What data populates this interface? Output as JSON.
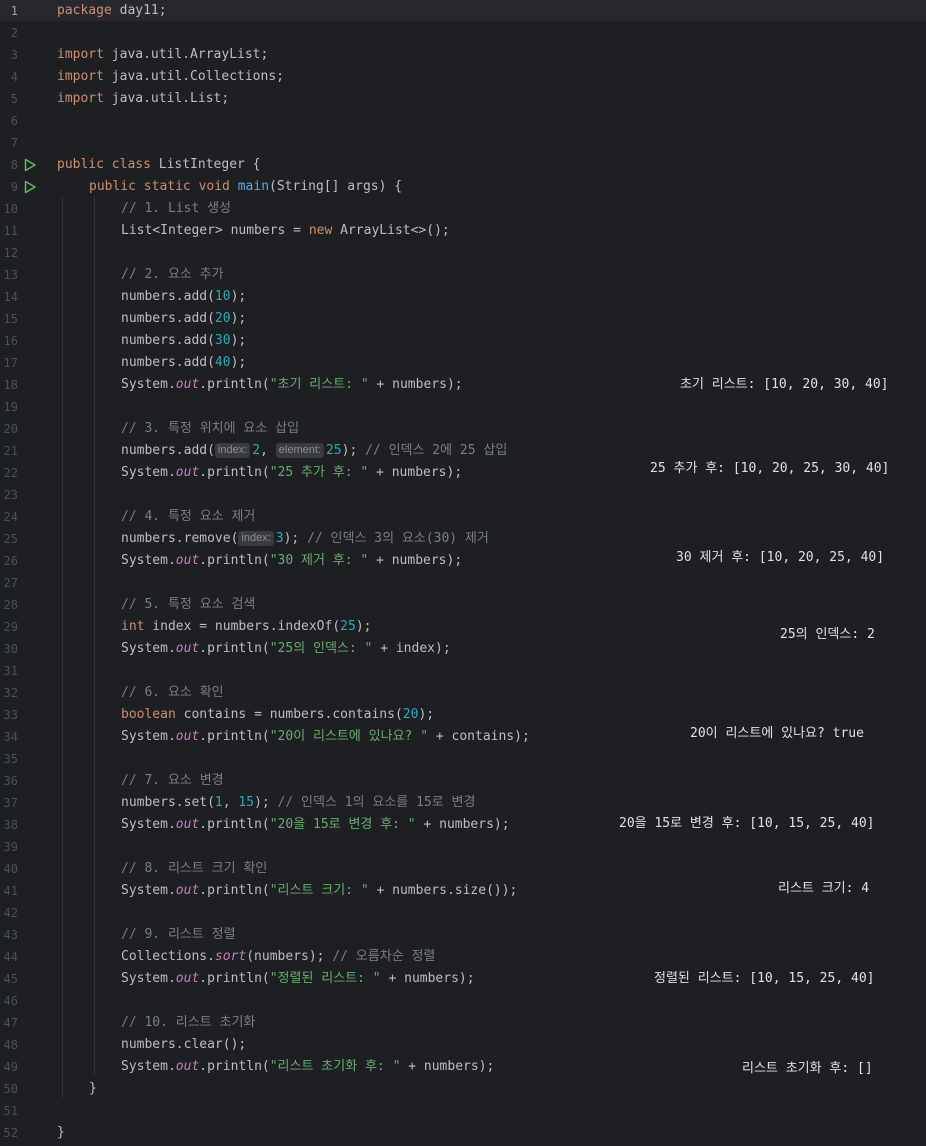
{
  "editor": {
    "line_numbers": [
      "1",
      "2",
      "3",
      "4",
      "5",
      "6",
      "7",
      "8",
      "9",
      "10",
      "11",
      "12",
      "13",
      "14",
      "15",
      "16",
      "17",
      "18",
      "19",
      "20",
      "21",
      "22",
      "23",
      "24",
      "25",
      "26",
      "27",
      "28",
      "29",
      "30",
      "31",
      "32",
      "33",
      "34",
      "35",
      "36",
      "37",
      "38",
      "39",
      "40",
      "41",
      "42",
      "43",
      "44",
      "45",
      "46",
      "47",
      "48",
      "49",
      "50",
      "51",
      "52"
    ],
    "code": {
      "l1": {
        "kw": "package",
        "rest": " day11;"
      },
      "l3": {
        "kw": "import",
        "rest": " java.util.ArrayList;"
      },
      "l4": {
        "kw": "import",
        "rest": " java.util.Collections;"
      },
      "l5": {
        "kw": "import",
        "rest": " java.util.List;"
      },
      "l8": {
        "kw": "public class",
        "rest": " ListInteger {"
      },
      "l9": {
        "kw": "public static void",
        "fn": "main",
        "rest": "(String[] args) {"
      },
      "l10": "// 1. List 생성",
      "l11": {
        "a": "List<Integer> numbers = ",
        "kw": "new",
        "b": " ArrayList<>();"
      },
      "l13": "// 2. 요소 추가",
      "l14": {
        "a": "numbers.add(",
        "n": "10",
        "b": ");"
      },
      "l15": {
        "a": "numbers.add(",
        "n": "20",
        "b": ");"
      },
      "l16": {
        "a": "numbers.add(",
        "n": "30",
        "b": ");"
      },
      "l17": {
        "a": "numbers.add(",
        "n": "40",
        "b": ");"
      },
      "l18": {
        "a": "System.",
        "f": "out",
        "b": ".println(",
        "s": "\"초기 리스트: \"",
        "c": " + numbers);"
      },
      "l20": "// 3. 특정 위치에 요소 삽입",
      "l21": {
        "a": "numbers.add(",
        "h1": "index:",
        "n1": "2",
        ",": ", ",
        "h2": "element:",
        "n2": "25",
        "b": "); ",
        "cm": "// 인덱스 2에 25 삽입"
      },
      "l22": {
        "a": "System.",
        "f": "out",
        "b": ".println(",
        "s": "\"25 추가 후: \"",
        "c": " + numbers);"
      },
      "l24": "// 4. 특정 요소 제거",
      "l25": {
        "a": "numbers.remove(",
        "h": "index:",
        "n": "3",
        "b": "); ",
        "cm": "// 인덱스 3의 요소(30) 제거"
      },
      "l26": {
        "a": "System.",
        "f": "out",
        "b": ".println(",
        "s": "\"30 제거 후: \"",
        "c": " + numbers);"
      },
      "l28": "// 5. 특정 요소 검색",
      "l29": {
        "kw": "int",
        "a": " index = numbers.indexOf(",
        "n": "25",
        "b": ");"
      },
      "l30": {
        "a": "System.",
        "f": "out",
        "b": ".println(",
        "s": "\"25의 인덱스: \"",
        "c": " + index);"
      },
      "l32": "// 6. 요소 확인",
      "l33": {
        "kw": "boolean",
        "a": " contains = numbers.contains(",
        "n": "20",
        "b": ");"
      },
      "l34": {
        "a": "System.",
        "f": "out",
        "b": ".println(",
        "s": "\"20이 리스트에 있나요? \"",
        "c": " + contains);"
      },
      "l36": "// 7. 요소 변경",
      "l37": {
        "a": "numbers.set(",
        "n1": "1",
        ",": ", ",
        "n2": "15",
        "b": "); ",
        "cm": "// 인덱스 1의 요소를 15로 변경"
      },
      "l38": {
        "a": "System.",
        "f": "out",
        "b": ".println(",
        "s": "\"20을 15로 변경 후: \"",
        "c": " + numbers);"
      },
      "l40": "// 8. 리스트 크기 확인",
      "l41": {
        "a": "System.",
        "f": "out",
        "b": ".println(",
        "s": "\"리스트 크기: \"",
        "c": " + numbers.size());"
      },
      "l43": "// 9. 리스트 정렬",
      "l44": {
        "a": "Collections.",
        "f": "sort",
        "b": "(numbers); ",
        "cm": "// 오름차순 정렬"
      },
      "l45": {
        "a": "System.",
        "f": "out",
        "b": ".println(",
        "s": "\"정렬된 리스트: \"",
        "c": " + numbers);"
      },
      "l47": "// 10. 리스트 초기화",
      "l48": "numbers.clear();",
      "l49": {
        "a": "System.",
        "f": "out",
        "b": ".println(",
        "s": "\"리스트 초기화 후: \"",
        "c": " + numbers);"
      },
      "l50": "}",
      "l52": "}"
    },
    "outputs": {
      "o18": "초기 리스트: [10, 20, 30, 40]",
      "o22": "25 추가 후: [10, 20, 25, 30, 40]",
      "o26": "30 제거 후: [10, 20, 25, 40]",
      "o29": "25의 인덱스: 2",
      "o34": "20이 리스트에 있나요? true",
      "o38": "20을 15로 변경 후: [10, 15, 25, 40]",
      "o41": "리스트 크기: 4",
      "o45": "정렬된 리스트: [10, 15, 25, 40]",
      "o49": "리스트 초기화 후: []"
    },
    "icons": {
      "run": "run-gutter-icon"
    },
    "colors": {
      "background": "#1e1f22",
      "keyword": "#cf8e6d",
      "string": "#6aab73",
      "number": "#2aacb8",
      "comment": "#7a7e85",
      "static_field": "#c77dbb",
      "method": "#56a8f5",
      "run_icon": "#5fb865"
    }
  }
}
